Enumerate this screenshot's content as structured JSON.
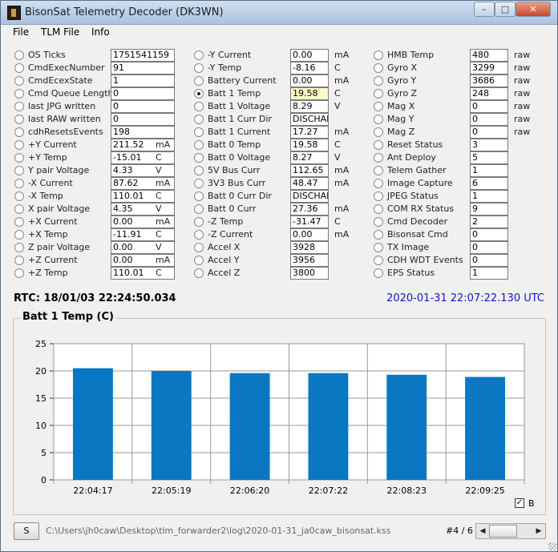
{
  "window": {
    "title": "BisonSat Telemetry Decoder (DK3WN)"
  },
  "menu": [
    "File",
    "TLM File",
    "Info"
  ],
  "columns": [
    [
      {
        "label": "OS Ticks",
        "value": "1751541159",
        "unit": ""
      },
      {
        "label": "CmdExecNumber",
        "value": "91",
        "unit": ""
      },
      {
        "label": "CmdEcexState",
        "value": "1",
        "unit": ""
      },
      {
        "label": "Cmd Queue Length",
        "value": "0",
        "unit": ""
      },
      {
        "label": "last JPG written",
        "value": "0",
        "unit": ""
      },
      {
        "label": "last RAW written",
        "value": "0",
        "unit": ""
      },
      {
        "label": "cdhResetsEvents",
        "value": "198",
        "unit": ""
      },
      {
        "label": "+Y Current",
        "value": "211.52",
        "unit": "mA"
      },
      {
        "label": "+Y Temp",
        "value": "-15.01",
        "unit": "C"
      },
      {
        "label": "Y pair Voltage",
        "value": "4.33",
        "unit": "V"
      },
      {
        "label": "-X Current",
        "value": "87.62",
        "unit": "mA"
      },
      {
        "label": "-X Temp",
        "value": "110.01",
        "unit": "C"
      },
      {
        "label": "X pair Voltage",
        "value": "4.35",
        "unit": "V"
      },
      {
        "label": "+X Current",
        "value": "0.00",
        "unit": "mA"
      },
      {
        "label": "+X Temp",
        "value": "-11.91",
        "unit": "C"
      },
      {
        "label": "Z pair Voltage",
        "value": "0.00",
        "unit": "V"
      },
      {
        "label": "+Z Current",
        "value": "0.00",
        "unit": "mA"
      },
      {
        "label": "+Z Temp",
        "value": "110.01",
        "unit": "C"
      }
    ],
    [
      {
        "label": "-Y Current",
        "value": "0.00",
        "unit": "mA"
      },
      {
        "label": "-Y Temp",
        "value": "-8.16",
        "unit": "C"
      },
      {
        "label": "Battery Current",
        "value": "0.00",
        "unit": "mA"
      },
      {
        "label": "Batt 1 Temp",
        "value": "19.58",
        "unit": "C",
        "selected": true
      },
      {
        "label": "Batt 1 Voltage",
        "value": "8.29",
        "unit": "V"
      },
      {
        "label": "Batt 1 Curr Dir",
        "value": "DISCHARGE",
        "unit": ""
      },
      {
        "label": "Batt 1 Current",
        "value": "17.27",
        "unit": "mA"
      },
      {
        "label": "Batt 0 Temp",
        "value": "19.58",
        "unit": "C"
      },
      {
        "label": "Batt 0 Voltage",
        "value": "8.27",
        "unit": "V"
      },
      {
        "label": "5V Bus Curr",
        "value": "112.65",
        "unit": "mA"
      },
      {
        "label": "3V3 Bus Curr",
        "value": "48.47",
        "unit": "mA"
      },
      {
        "label": "Batt 0 Curr Dir",
        "value": "DISCHARGE",
        "unit": ""
      },
      {
        "label": "Batt 0 Curr",
        "value": "27.36",
        "unit": "mA"
      },
      {
        "label": "-Z Temp",
        "value": "-31.47",
        "unit": "C"
      },
      {
        "label": "-Z Current",
        "value": "0.00",
        "unit": "mA"
      },
      {
        "label": "Accel X",
        "value": "3928",
        "unit": ""
      },
      {
        "label": "Accel Y",
        "value": "3956",
        "unit": ""
      },
      {
        "label": "Accel Z",
        "value": "3800",
        "unit": ""
      }
    ],
    [
      {
        "label": "HMB Temp",
        "value": "480",
        "unit": "raw"
      },
      {
        "label": "Gyro X",
        "value": "3299",
        "unit": "raw"
      },
      {
        "label": "Gyro Y",
        "value": "3686",
        "unit": "raw"
      },
      {
        "label": "Gyro Z",
        "value": "248",
        "unit": "raw"
      },
      {
        "label": "Mag X",
        "value": "0",
        "unit": "raw"
      },
      {
        "label": "Mag Y",
        "value": "0",
        "unit": "raw"
      },
      {
        "label": "Mag Z",
        "value": "0",
        "unit": "raw"
      },
      {
        "label": "Reset Status",
        "value": "3",
        "unit": ""
      },
      {
        "label": "Ant Deploy",
        "value": "5",
        "unit": ""
      },
      {
        "label": "Telem Gather",
        "value": "1",
        "unit": ""
      },
      {
        "label": "Image Capture",
        "value": "6",
        "unit": ""
      },
      {
        "label": "JPEG Status",
        "value": "1",
        "unit": ""
      },
      {
        "label": "COM RX Status",
        "value": "9",
        "unit": ""
      },
      {
        "label": "Cmd Decoder",
        "value": "2",
        "unit": ""
      },
      {
        "label": "Bisonsat Cmd",
        "value": "0",
        "unit": ""
      },
      {
        "label": "TX Image",
        "value": "0",
        "unit": ""
      },
      {
        "label": "CDH WDT Events",
        "value": "0",
        "unit": ""
      },
      {
        "label": "EPS Status",
        "value": "1",
        "unit": ""
      }
    ]
  ],
  "status": {
    "rtc": "RTC: 18/01/03 22:24:50.034",
    "utc": "2020-01-31  22:07:22.130 UTC"
  },
  "chart_data": {
    "type": "bar",
    "title": "Batt 1 Temp (C)",
    "categories": [
      "22:04:17",
      "22:05:19",
      "22:06:20",
      "22:07:22",
      "22:08:23",
      "22:09:25"
    ],
    "values": [
      20.5,
      20.0,
      19.6,
      19.6,
      19.3,
      18.9
    ],
    "ylim": [
      0,
      25
    ],
    "yticks": [
      "25",
      "20",
      "15",
      "10",
      "5",
      "0"
    ],
    "grid": true,
    "bar_color": "#0a77c2",
    "legend_label": "B",
    "legend_checked": true
  },
  "footer": {
    "button_label": "S",
    "file_path": "C:\\Users\\jh0caw\\Desktop\\tlm_forwarder2\\log\\2020-01-31_ja0caw_bisonsat.kss",
    "page_counter": "#4 / 6"
  }
}
